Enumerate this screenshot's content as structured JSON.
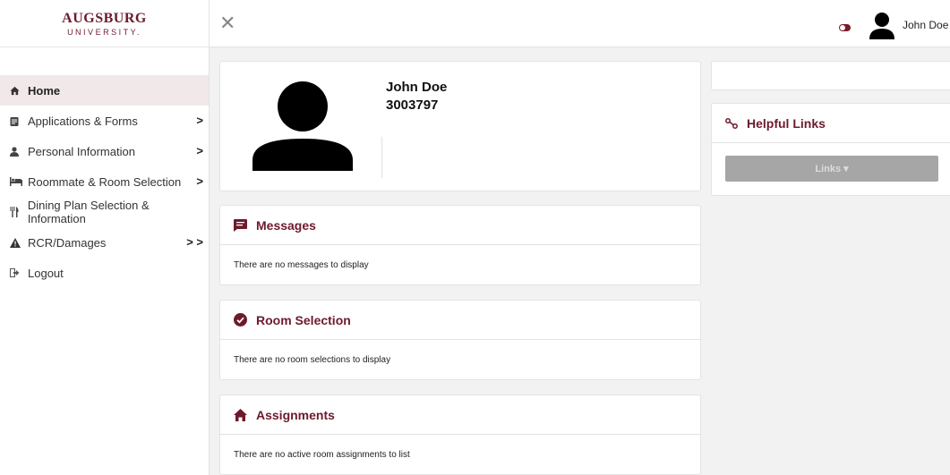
{
  "logo": {
    "line1": "AUGSBURG",
    "line2": "UNIVERSITY."
  },
  "topbar": {
    "user_name": "John Doe"
  },
  "nav": [
    {
      "label": "Home",
      "icon": "home-icon",
      "chevron": ""
    },
    {
      "label": "Applications & Forms",
      "icon": "clipboard-icon",
      "chevron": ">"
    },
    {
      "label": "Personal Information",
      "icon": "user-icon",
      "chevron": ">"
    },
    {
      "label": "Roommate & Room Selection",
      "icon": "bed-icon",
      "chevron": ">"
    },
    {
      "label": "Dining Plan Selection & Information",
      "icon": "utensils-icon",
      "chevron": ""
    },
    {
      "label": "RCR/Damages",
      "icon": "warning-icon",
      "chevron": "> >"
    },
    {
      "label": "Logout",
      "icon": "logout-icon",
      "chevron": ""
    }
  ],
  "profile": {
    "name": "John Doe",
    "student_id": "3003797"
  },
  "messages": {
    "title": "Messages",
    "body": "There are no messages to display"
  },
  "room_selection": {
    "title": "Room Selection",
    "body": "There are no room selections to display"
  },
  "assignments": {
    "title": "Assignments",
    "body": "There are no active room assignments to list"
  },
  "helpful_links": {
    "title": "Helpful Links",
    "button_label": "Links ▾"
  },
  "colors": {
    "accent": "#6d1a2c",
    "toggle": "#7b1a2a",
    "active_bg": "#f1e8ea",
    "button_disabled": "#a6a6a6"
  }
}
